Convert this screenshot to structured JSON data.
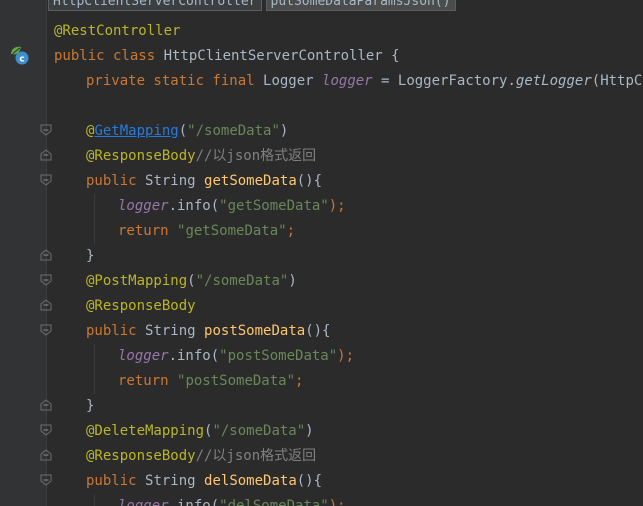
{
  "breadcrumbs": [
    "HttpClientServerController",
    "putSomeDataParamsJson()"
  ],
  "colors": {
    "background": "#2b2b2b",
    "gutter": "#313335",
    "annotation": "#bbb529",
    "keyword": "#cc7832",
    "string": "#6a8759",
    "field": "#9876aa",
    "method": "#ffc66d",
    "comment": "#808080"
  },
  "code": {
    "l1": {
      "ann": "@RestController"
    },
    "l2": {
      "kw": "public class ",
      "name": "HttpClientServerController {"
    },
    "l3": {
      "kw": "private static final ",
      "type": "Logger ",
      "fld": "logger",
      "eq": " = LoggerFactory.",
      "call": "getLogger",
      "rest": "(HttpClien"
    },
    "l5": {
      "at": "@",
      "ann": "GetMapping",
      "p1": "(",
      "str": "\"/someData\"",
      "p2": ")"
    },
    "l6": {
      "ann": "@ResponseBody",
      "cmt": "//以json格式返回"
    },
    "l7": {
      "kw": "public ",
      "type": "String ",
      "mth": "getSomeData",
      "rest": "(){"
    },
    "l8": {
      "fld": "logger",
      "dot": ".info(",
      "str": "\"getSomeData\"",
      "end": ");"
    },
    "l9": {
      "kw": "return ",
      "str": "\"getSomeData\"",
      "end": ";"
    },
    "l10": {
      "brace": "}"
    },
    "l11": {
      "ann": "@PostMapping",
      "p1": "(",
      "str": "\"/someData\"",
      "p2": ")"
    },
    "l12": {
      "ann": "@ResponseBody"
    },
    "l13": {
      "kw": "public ",
      "type": "String ",
      "mth": "postSomeData",
      "rest": "(){"
    },
    "l14": {
      "fld": "logger",
      "dot": ".info(",
      "str": "\"postSomeData\"",
      "end": ");"
    },
    "l15": {
      "kw": "return ",
      "str": "\"postSomeData\"",
      "end": ";"
    },
    "l16": {
      "brace": "}"
    },
    "l17": {
      "ann": "@DeleteMapping",
      "p1": "(",
      "str": "\"/someData\"",
      "p2": ")"
    },
    "l18": {
      "ann": "@ResponseBody",
      "cmt": "//以json格式返回"
    },
    "l19": {
      "kw": "public ",
      "type": "String ",
      "mth": "delSomeData",
      "rest": "(){"
    },
    "l20": {
      "fld": "logger",
      "dot": ".info(",
      "str": "\"delSomeData\"",
      "end": ");"
    }
  },
  "gutter_icons": [
    "spring-controller-icon",
    "fold-marker-icon"
  ]
}
